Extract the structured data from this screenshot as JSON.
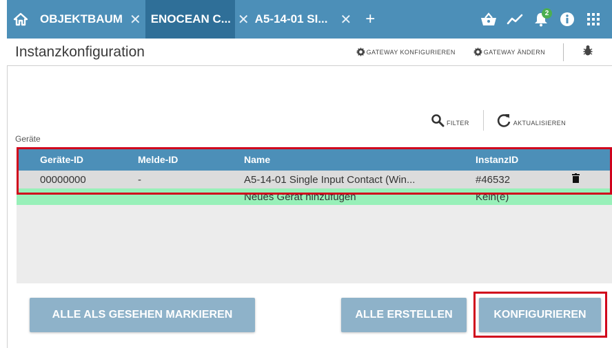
{
  "tabs": [
    {
      "label": "OBJEKTBAUM",
      "active": false
    },
    {
      "label": "ENOCEAN C...",
      "active": true
    },
    {
      "label": "A5-14-01 SI...",
      "active": false
    }
  ],
  "tab_close_glyph": "✕",
  "add_tab_glyph": "+",
  "topbar_icons": [
    "basket-icon",
    "trend-icon",
    "bell-icon",
    "info-icon",
    "grid-icon"
  ],
  "notification_count": "2",
  "page_title": "Instanzkonfiguration",
  "header_actions": {
    "gateway_configure": "GATEWAY KONFIGURIEREN",
    "gateway_change": "GATEWAY ÄNDERN"
  },
  "toolbar": {
    "filter_label": "FILTER",
    "refresh_label": "AKTUALISIEREN"
  },
  "section_label": "Geräte",
  "table": {
    "columns": [
      "Geräte-ID",
      "Melde-ID",
      "Name",
      "InstanzID"
    ],
    "rows": [
      {
        "device_id": "00000000",
        "report_id": "-",
        "name": "A5-14-01 Single Input Contact (Win...",
        "instance_id": "#46532"
      }
    ],
    "add_row": {
      "name": "Neues Gerät hinzufügen",
      "instance_id": "Kein(e)"
    }
  },
  "buttons": {
    "mark_all_seen": "ALLE ALS GESEHEN MARKIEREN",
    "create_all": "ALLE ERSTELLEN",
    "configure": "KONFIGURIEREN"
  },
  "colors": {
    "primary": "#4c8fb8",
    "active_tab": "#2f6f98",
    "button": "#8eb2c9",
    "add_row": "#98f0b9",
    "highlight": "#d0021b",
    "badge": "#4caf50"
  }
}
